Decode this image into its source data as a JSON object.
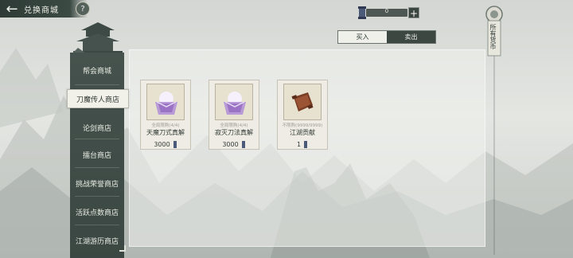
{
  "header": {
    "title": "兑换商城",
    "help_label": "?"
  },
  "currency": {
    "icon": "scroll-token-icon",
    "value": "0",
    "add_label": "+"
  },
  "trade_toggle": {
    "buy": "买入",
    "sell": "卖出",
    "selected": "buy"
  },
  "side_scroll": {
    "text": "所有货币"
  },
  "sidebar": {
    "items": [
      {
        "label": "帮会商城",
        "active": false
      },
      {
        "label": "刀魔传人商店",
        "active": true
      },
      {
        "label": "论剑商店",
        "active": false
      },
      {
        "label": "擂台商店",
        "active": false
      },
      {
        "label": "挑战荣誉商店",
        "active": false
      },
      {
        "label": "活跃点数商店",
        "active": false
      },
      {
        "label": "江湖游历商店",
        "active": false
      }
    ]
  },
  "items": [
    {
      "name": "天魔刀式真解",
      "limit": "全局限购(4/4)",
      "price": "3000",
      "icon": "purple-scroll-icon"
    },
    {
      "name": "寂灭刀法真解",
      "limit": "全局限购(4/4)",
      "price": "3000",
      "icon": "purple-scroll-icon"
    },
    {
      "name": "江湖贡献",
      "limit": "不限购(9999/9999)",
      "price": "1",
      "icon": "brown-scroll-icon"
    }
  ],
  "colors": {
    "sidebar_bg": "#3f4b46",
    "active_tab_bg": "#f2f1e9",
    "panel_bg": "#eef0ec"
  }
}
